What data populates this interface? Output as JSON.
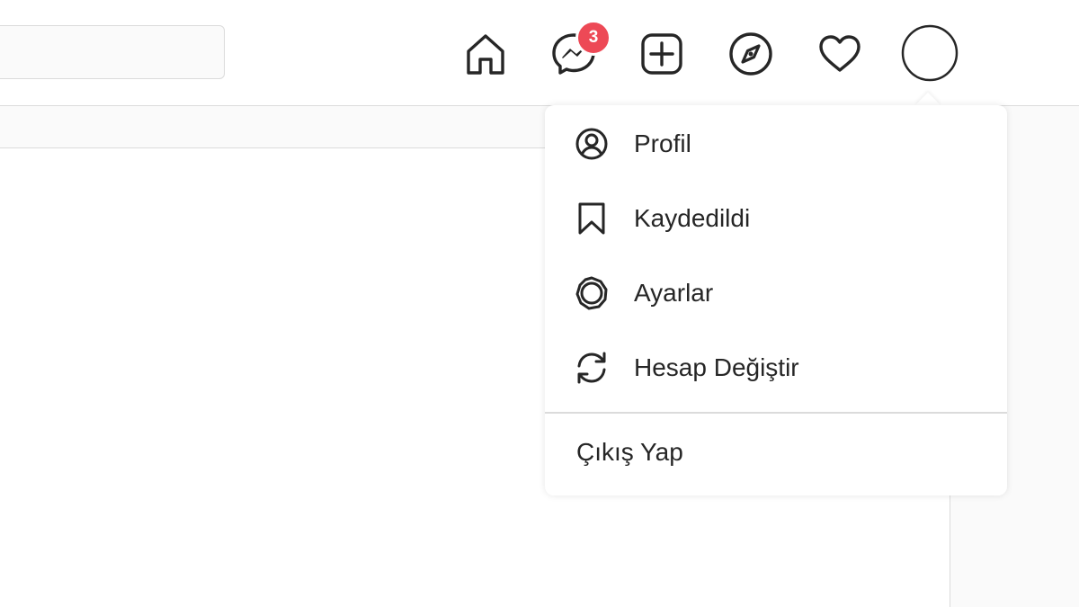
{
  "topbar": {
    "search": {
      "placeholder": ""
    },
    "icons": [
      "home-icon",
      "messenger-icon",
      "new-post-icon",
      "explore-icon",
      "activity-heart-icon",
      "profile-avatar"
    ],
    "messages_badge": "3"
  },
  "dropdown": {
    "items": [
      {
        "label": "Profil",
        "icon": "profile-icon"
      },
      {
        "label": "Kaydedildi",
        "icon": "bookmark-icon"
      },
      {
        "label": "Ayarlar",
        "icon": "settings-icon"
      },
      {
        "label": "Hesap Değiştir",
        "icon": "switch-account-icon"
      }
    ],
    "logout": "Çıkış Yap"
  },
  "colors": {
    "badge": "#ed4956",
    "text": "#262626",
    "border": "#dbdbdb"
  }
}
